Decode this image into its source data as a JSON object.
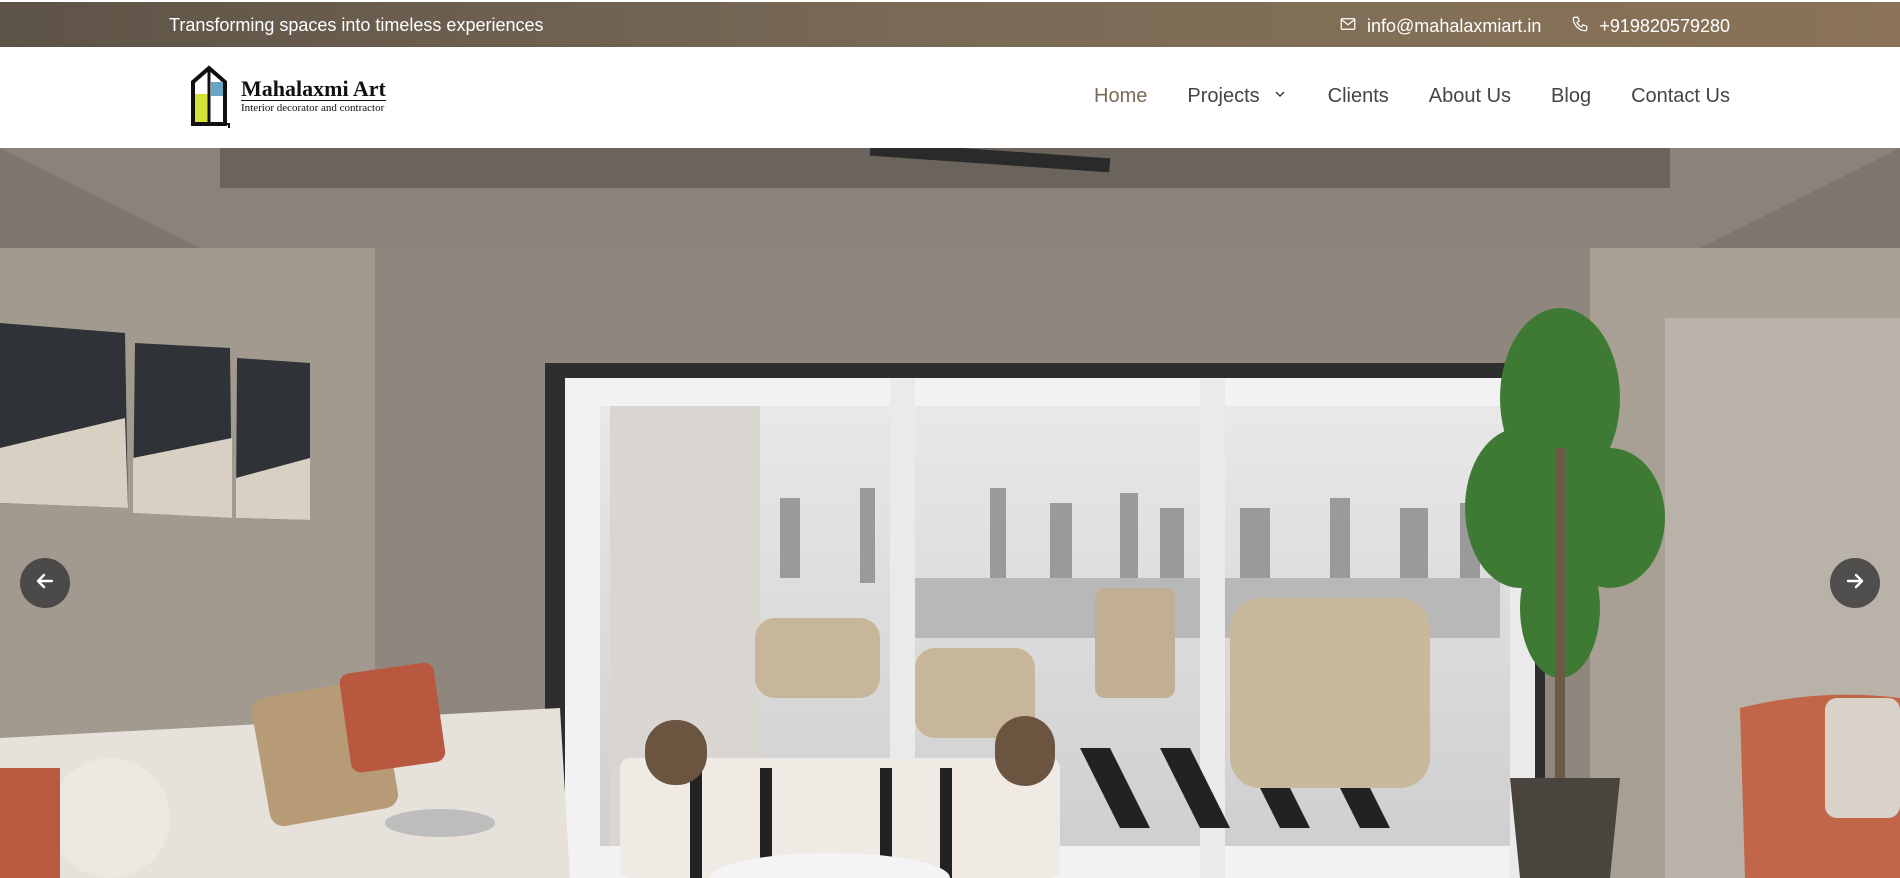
{
  "topbar": {
    "tagline": "Transforming spaces into timeless experiences",
    "email": "info@mahalaxmiart.in",
    "phone": "+919820579280",
    "email_icon": "mail-icon",
    "phone_icon": "phone-icon"
  },
  "logo": {
    "name": "Mahalaxmi Art",
    "subtitle": "Interior decorator and contractor"
  },
  "nav": {
    "items": [
      {
        "label": "Home",
        "active": true
      },
      {
        "label": "Projects",
        "has_dropdown": true
      },
      {
        "label": "Clients"
      },
      {
        "label": "About Us"
      },
      {
        "label": "Blog"
      },
      {
        "label": "Contact Us"
      }
    ]
  },
  "hero": {
    "prev_icon": "arrow-left-icon",
    "next_icon": "arrow-right-icon"
  },
  "colors": {
    "topbar_start": "#5e5347",
    "topbar_end": "#8a7357",
    "nav_active": "#7a6b57"
  }
}
